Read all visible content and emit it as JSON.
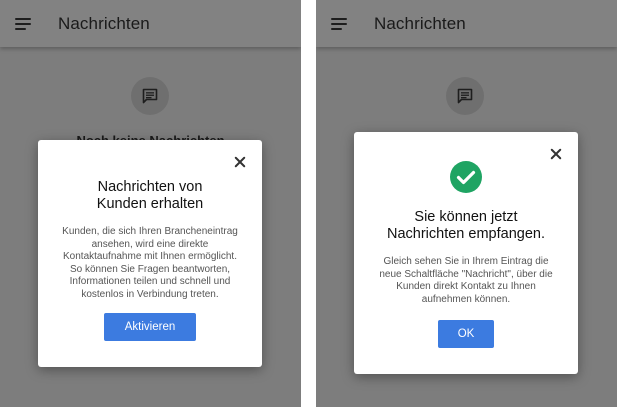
{
  "colors": {
    "accent": "#3c7be0",
    "success": "#1fa463",
    "overlay": "#7d7d7d"
  },
  "left_screen": {
    "appbar": {
      "title": "Nachrichten",
      "menu_icon": "menu-icon"
    },
    "background_text": "Noch keine Nachrichten",
    "dialog": {
      "title_line1": "Nachrichten von",
      "title_line2": "Kunden erhalten",
      "body_lines": [
        "Kunden, die sich Ihren Brancheneintrag",
        "ansehen, wird eine direkte",
        "Kontaktaufnahme mit Ihnen ermöglicht.",
        "So können Sie Fragen beantworten,",
        "Informationen teilen und schnell und",
        "kostenlos in Verbindung treten."
      ],
      "button_label": "Aktivieren",
      "close_icon": "close-icon"
    }
  },
  "right_screen": {
    "appbar": {
      "title": "Nachrichten",
      "menu_icon": "menu-icon"
    },
    "dialog": {
      "icon": "check-circle-icon",
      "title_line1": "Sie können jetzt",
      "title_line2": "Nachrichten empfangen.",
      "body_lines": [
        "Gleich sehen Sie in Ihrem Eintrag die",
        "neue Schaltfläche \"Nachricht\", über die",
        "Kunden direkt Kontakt zu Ihnen",
        "aufnehmen können."
      ],
      "button_label": "OK",
      "close_icon": "close-icon"
    }
  }
}
